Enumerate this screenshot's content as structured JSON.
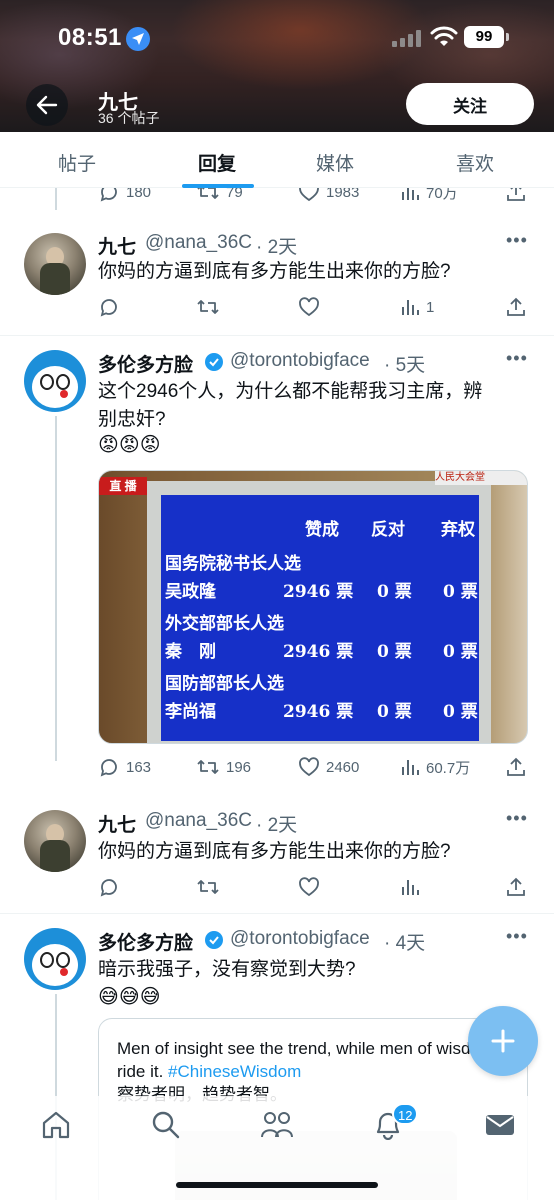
{
  "status_bar": {
    "time": "08:51",
    "battery": "99"
  },
  "profile": {
    "name": "九七",
    "post_count": "36 个帖子",
    "follow_label": "关注"
  },
  "tabs": [
    {
      "label": "帖子"
    },
    {
      "label": "回复",
      "active": true
    },
    {
      "label": "媒体"
    },
    {
      "label": "喜欢"
    }
  ],
  "partial_actions": {
    "replies": "180",
    "reposts": "79",
    "likes": "1983",
    "views": "70万"
  },
  "posts": [
    {
      "author": "九七",
      "handle": "@nana_36C",
      "time": "· 2天",
      "text": "你妈的方逼到底有多方能生出来你的方脸?",
      "actions": {
        "replies": "",
        "reposts": "",
        "likes": "",
        "views": "1"
      }
    },
    {
      "author": "多伦多方脸",
      "handle": "@torontobigface",
      "time": "· 5天",
      "verified": true,
      "text_line1": "这个2946个人，为什么都不能帮我习主席，辨",
      "text_line2": "别忠奸?",
      "emojis": "😡😡😡",
      "media": {
        "tag": "直 播",
        "channel": "人民大会堂",
        "header": [
          "赞成",
          "反对",
          "弃权"
        ],
        "rows": [
          {
            "title": "国务院秘书长人选",
            "person": "吴政隆",
            "for": "2946 票",
            "against": "0 票",
            "abstain": "0 票"
          },
          {
            "title": "外交部部长人选",
            "person": "秦　刚",
            "for": "2946 票",
            "against": "0 票",
            "abstain": "0 票"
          },
          {
            "title": "国防部部长人选",
            "person": "李尚福",
            "for": "2946 票",
            "against": "0 票",
            "abstain": "0 票"
          }
        ]
      },
      "actions": {
        "replies": "163",
        "reposts": "196",
        "likes": "2460",
        "views": "60.7万"
      }
    },
    {
      "author": "九七",
      "handle": "@nana_36C",
      "time": "· 2天",
      "text": "你妈的方逼到底有多方能生出来你的方脸?",
      "actions": {
        "replies": "",
        "reposts": "",
        "likes": "",
        "views": ""
      }
    },
    {
      "author": "多伦多方脸",
      "handle": "@torontobigface",
      "time": "· 4天",
      "verified": true,
      "text": "暗示我强子，没有察觉到大势?",
      "emojis": "😅😅😅",
      "quote": {
        "text_en": "Men of insight see the trend, while men of wisdom ride it.",
        "hashtag": "#ChineseWisdom",
        "text_zh": "察势者明，趋势者智。"
      }
    }
  ],
  "notifications_badge": "12",
  "colors": {
    "accent": "#1d9bf0",
    "text": "#0f1419",
    "secondary": "#536471"
  }
}
